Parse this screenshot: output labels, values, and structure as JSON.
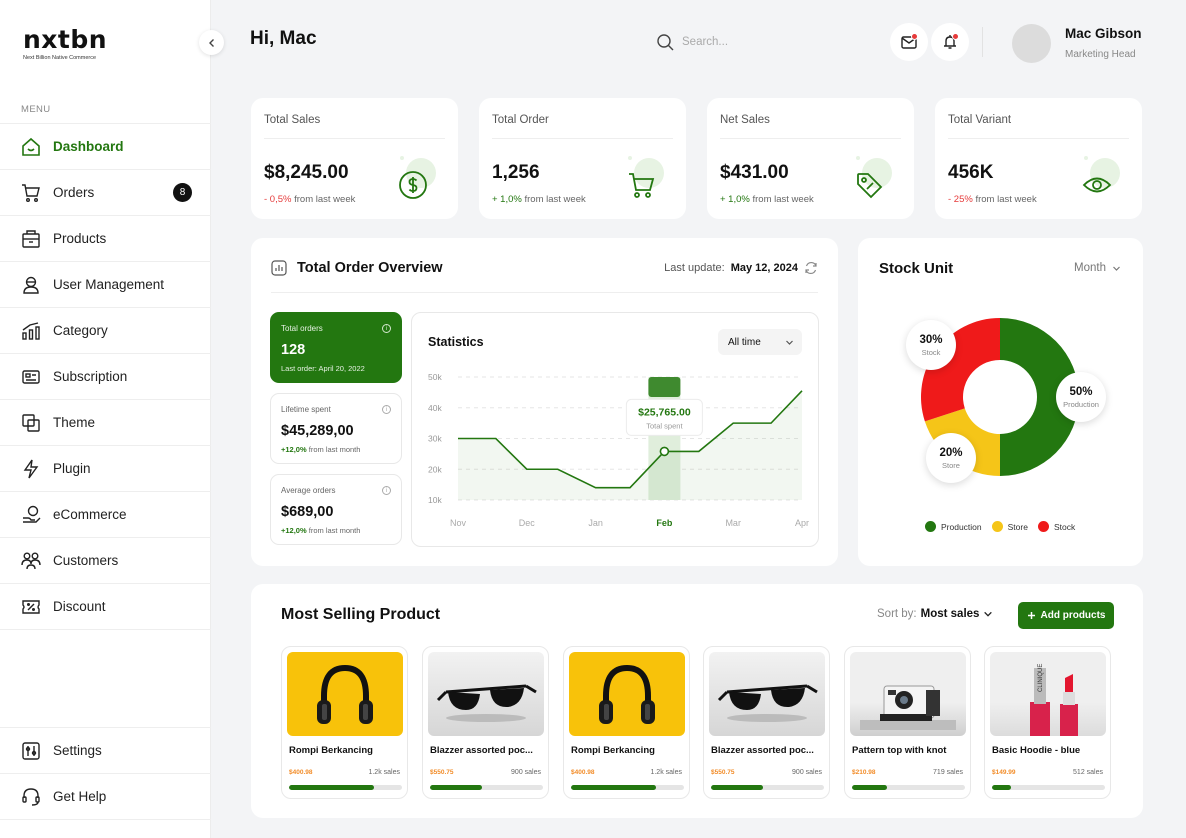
{
  "brand": {
    "name": "nxtbn",
    "tagline": "Next Billion Native Commerce"
  },
  "sidebar": {
    "menu_label": "MENU",
    "items": [
      {
        "label": "Dashboard",
        "icon": "home-icon",
        "active": true
      },
      {
        "label": "Orders",
        "icon": "cart-icon",
        "badge": "8"
      },
      {
        "label": "Products",
        "icon": "box-icon"
      },
      {
        "label": "User Management",
        "icon": "user-icon"
      },
      {
        "label": "Category",
        "icon": "chart-icon"
      },
      {
        "label": "Subscription",
        "icon": "card-icon"
      },
      {
        "label": "Theme",
        "icon": "layers-icon"
      },
      {
        "label": "Plugin",
        "icon": "lightning-icon"
      },
      {
        "label": "eCommerce",
        "icon": "coin-hand-icon"
      },
      {
        "label": "Customers",
        "icon": "users-icon"
      },
      {
        "label": "Discount",
        "icon": "ticket-icon"
      }
    ],
    "bottom": [
      {
        "label": "Settings",
        "icon": "sliders-icon"
      },
      {
        "label": "Get Help",
        "icon": "headset-icon"
      }
    ]
  },
  "header": {
    "greeting": "Hi, Mac",
    "search_placeholder": "Search...",
    "user_name": "Mac Gibson",
    "user_role": "Marketing Head"
  },
  "stats": [
    {
      "title": "Total Sales",
      "value": "$8,245.00",
      "change": "- 0,5%",
      "change_dir": "down",
      "suffix": "from last week",
      "icon": "dollar-icon"
    },
    {
      "title": "Total Order",
      "value": "1,256",
      "change": "+ 1,0%",
      "change_dir": "up",
      "suffix": "from last week",
      "icon": "cart-icon"
    },
    {
      "title": "Net Sales",
      "value": "$431.00",
      "change": "+ 1,0%",
      "change_dir": "up",
      "suffix": "from last week",
      "icon": "tag-icon"
    },
    {
      "title": "Total Variant",
      "value": "456K",
      "change": "- 25%",
      "change_dir": "down",
      "suffix": "from last week",
      "icon": "eye-icon"
    }
  ],
  "overview": {
    "title": "Total Order Overview",
    "last_update_label": "Last update:",
    "last_update_date": "May 12, 2024",
    "mini": [
      {
        "label": "Total orders",
        "value": "128",
        "sub": "Last order: April 20, 2022"
      },
      {
        "label": "Lifetime spent",
        "value": "$45,289,00",
        "sub_up": "+12,0%",
        "sub": "from last month"
      },
      {
        "label": "Average orders",
        "value": "$689,00",
        "sub_up": "+12,0%",
        "sub": "from last month"
      }
    ],
    "statistics_title": "Statistics",
    "filter": "All time",
    "tooltip_value": "$25,765.00",
    "tooltip_label": "Total spent"
  },
  "chart_data": {
    "type": "line",
    "title": "Statistics",
    "x_ticks": [
      "Nov",
      "Dec",
      "Jan",
      "Feb",
      "Mar",
      "Apr"
    ],
    "y_ticks": [
      "50k",
      "40k",
      "30k",
      "20k",
      "10k"
    ],
    "ylim": [
      10000,
      50000
    ],
    "highlight": "Feb",
    "series": [
      {
        "x": [
          0,
          0.55,
          1,
          1.45,
          2,
          2.5,
          3,
          3.5,
          4,
          4.55,
          5
        ],
        "values": [
          30000,
          30000,
          20000,
          20000,
          14000,
          14000,
          25800,
          25800,
          35000,
          35000,
          45500
        ]
      }
    ],
    "color": "#237710"
  },
  "stock": {
    "title": "Stock Unit",
    "period": "Month",
    "chart": {
      "type": "pie",
      "slices": [
        {
          "name": "Production",
          "value": 50,
          "label": "50%",
          "color": "#237710"
        },
        {
          "name": "Store",
          "value": 20,
          "label": "20%",
          "color": "#f5c518"
        },
        {
          "name": "Stock",
          "value": 30,
          "label": "30%",
          "color": "#ef1a1a"
        }
      ]
    }
  },
  "most_selling": {
    "title": "Most Selling Product",
    "sort_label": "Sort by:",
    "sort_value": "Most sales",
    "add_button": "Add products",
    "products": [
      {
        "name": "Rompi Berkancing",
        "price": "$400.98",
        "sales": "1.2k sales",
        "progress": 0.75,
        "image": "headphones"
      },
      {
        "name": "Blazzer assorted poc...",
        "price": "$550.75",
        "sales": "900 sales",
        "progress": 0.46,
        "image": "sunglasses"
      },
      {
        "name": "Rompi Berkancing",
        "price": "$400.98",
        "sales": "1.2k sales",
        "progress": 0.75,
        "image": "headphones"
      },
      {
        "name": "Blazzer assorted poc...",
        "price": "$550.75",
        "sales": "900 sales",
        "progress": 0.46,
        "image": "sunglasses"
      },
      {
        "name": "Pattern top with knot",
        "price": "$210.98",
        "sales": "719 sales",
        "progress": 0.31,
        "image": "camera"
      },
      {
        "name": "Basic Hoodie - blue",
        "price": "$149.99",
        "sales": "512 sales",
        "progress": 0.17,
        "image": "lipstick"
      }
    ]
  }
}
